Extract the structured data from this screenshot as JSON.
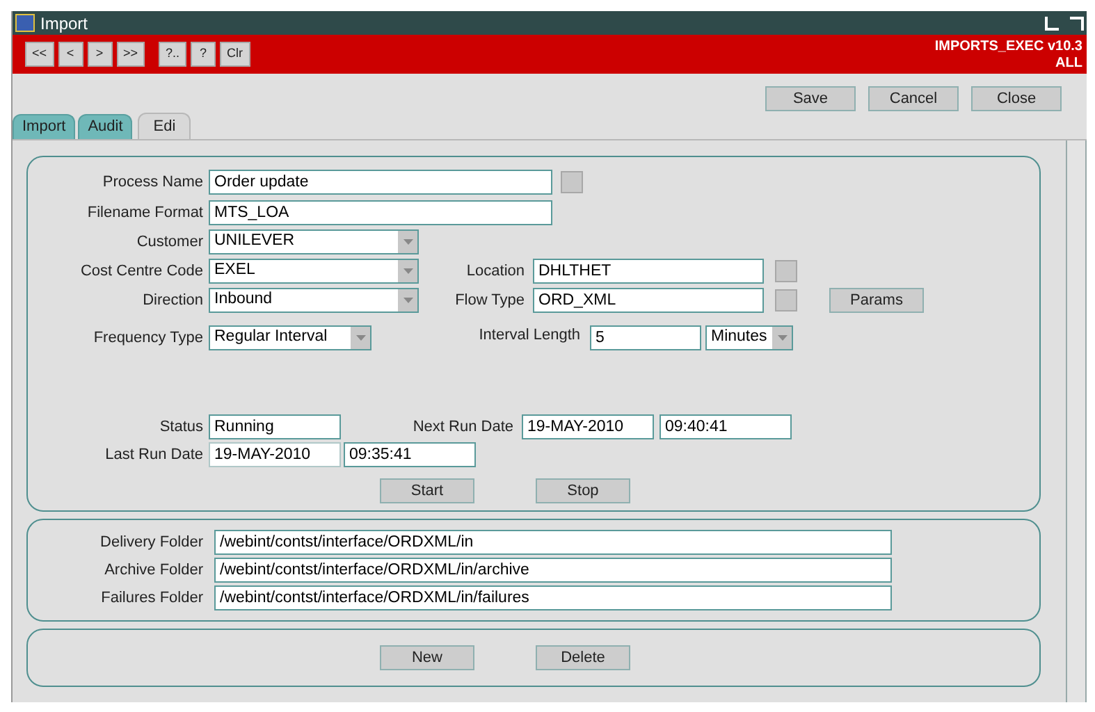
{
  "window": {
    "title": "Import"
  },
  "toolbar": {
    "buttons": [
      "<<",
      "<",
      ">",
      ">>",
      "?..",
      "?",
      "Clr"
    ],
    "app_name": "IMPORTS_EXEC v10.3",
    "scope": "ALL"
  },
  "actions": [
    "Save",
    "Cancel",
    "Close"
  ],
  "tabs": [
    {
      "label": "Import",
      "selected": false
    },
    {
      "label": "Audit",
      "selected": false
    },
    {
      "label": "Edi",
      "selected": true
    }
  ],
  "process": {
    "process_name": {
      "label": "Process Name",
      "value": "Order update"
    },
    "filename_format": {
      "label": "Filename Format",
      "value": "MTS_LOA"
    },
    "customer": {
      "label": "Customer",
      "value": "UNILEVER"
    },
    "cost_centre_code": {
      "label": "Cost Centre Code",
      "value": "EXEL"
    },
    "location": {
      "label": "Location",
      "value": "DHLTHET"
    },
    "direction": {
      "label": "Direction",
      "value": "Inbound"
    },
    "flow_type": {
      "label": "Flow Type",
      "value": "ORD_XML"
    },
    "params_button": "Params",
    "frequency_type": {
      "label": "Frequency Type",
      "value": "Regular Interval"
    },
    "interval_length": {
      "label": "Interval Length",
      "value": "5",
      "unit": "Minutes"
    },
    "status": {
      "label": "Status",
      "value": "Running"
    },
    "next_run_date": {
      "label": "Next Run Date",
      "date": {
        "value": "19-MAY-2010",
        "disabled": false
      },
      "time": {
        "value": "09:40:41",
        "disabled": false
      }
    },
    "last_run_date": {
      "label": "Last Run Date",
      "date": {
        "value": "19-MAY-2010",
        "disabled": true
      },
      "time": {
        "value": "09:35:41",
        "disabled": false
      }
    },
    "buttons": [
      "Start",
      "Stop"
    ]
  },
  "folders": [
    {
      "label": "Delivery Folder",
      "value": "/webint/contst/interface/ORDXML/in"
    },
    {
      "label": "Archive Folder",
      "value": "/webint/contst/interface/ORDXML/in/archive"
    },
    {
      "label": "Failures Folder",
      "value": "/webint/contst/interface/ORDXML/in/failures"
    }
  ],
  "record_buttons": [
    "New",
    "Delete"
  ]
}
